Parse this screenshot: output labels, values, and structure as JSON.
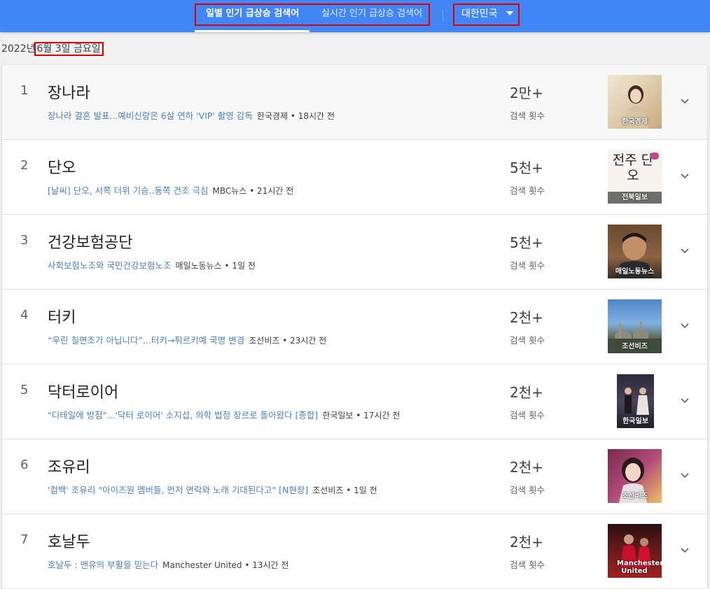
{
  "header": {
    "tab_daily": "일별 인기 급상승 검색어",
    "tab_realtime": "실시간 인기 급상승 검색어",
    "country": "대한민국"
  },
  "date": {
    "year": "2022년",
    "rest": "6월 3일 금요일"
  },
  "colors": {
    "topbar": "#4285f4",
    "link": "#4a7fc1",
    "highlight_box": "#e00000"
  },
  "items": [
    {
      "rank": "1",
      "term": "장나라",
      "story": "장나라 결혼 발표...예비신랑은 6살 연하 'VIP' 촬영 감독",
      "source": "한국경제 • 18시간 전",
      "count": "2만+",
      "count_label": "검색 횟수",
      "thumb_caption": "한국경제"
    },
    {
      "rank": "2",
      "term": "단오",
      "story": "[날씨] 단오, 서쪽 더위 기승..동쪽 건조 극심",
      "source": "MBC뉴스 • 21시간 전",
      "count": "5천+",
      "count_label": "검색 횟수",
      "thumb_caption": "전북일보",
      "thumb_text": "전주 단오"
    },
    {
      "rank": "3",
      "term": "건강보험공단",
      "story": "사회보험노조와 국민건강보험노조",
      "source": "매일노동뉴스 • 1일 전",
      "count": "5천+",
      "count_label": "검색 횟수",
      "thumb_caption": "매일노동뉴스"
    },
    {
      "rank": "4",
      "term": "터키",
      "story": "“우린 칠면조가 아닙니다”...터키→튀르키예 국명 변경",
      "source": "조선비즈 • 23시간 전",
      "count": "2천+",
      "count_label": "검색 횟수",
      "thumb_caption": "조선비즈"
    },
    {
      "rank": "5",
      "term": "닥터로이어",
      "story": "\"디테일에 방점\"...'닥터 로이어' 소지섭, 의학 법정 장르로 돌아왔다 [종합]",
      "source": "한국일보 • 17시간 전",
      "count": "2천+",
      "count_label": "검색 횟수",
      "thumb_caption": "한국일보"
    },
    {
      "rank": "6",
      "term": "조유리",
      "story": "'컴백' 조유리 \"아이즈원 멤버들, 먼저 연락와 노래 기대된다고\" [N현장]",
      "source": "조선비즈 • 1일 전",
      "count": "2천+",
      "count_label": "검색 횟수",
      "thumb_caption": "조선비즈"
    },
    {
      "rank": "7",
      "term": "호날두",
      "story": "호날두 : 맨유의 부활을 믿는다",
      "source": "Manchester United • 13시간 전",
      "count": "2천+",
      "count_label": "검색 횟수",
      "thumb_caption": "Manchester United"
    }
  ]
}
